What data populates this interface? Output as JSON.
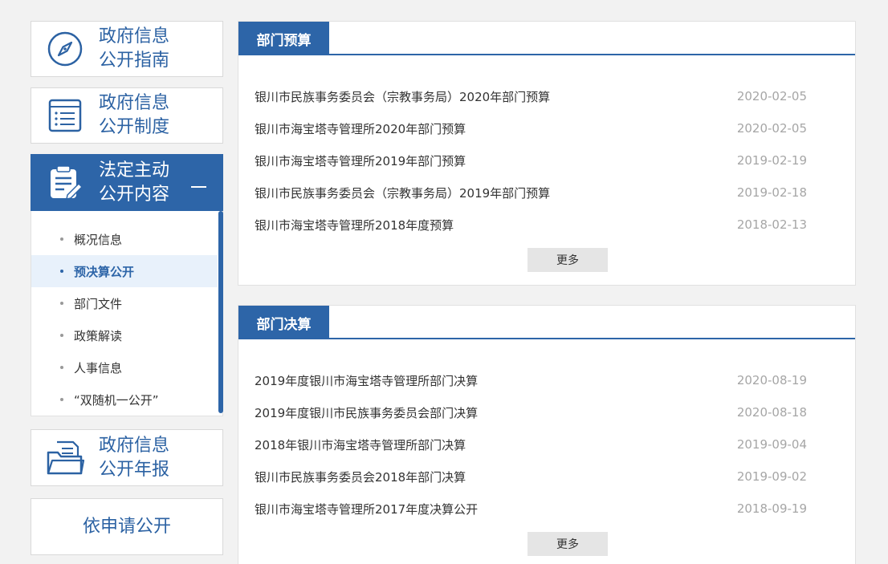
{
  "sidebar": {
    "guide_label": "政府信息\n公开指南",
    "system_label": "政府信息\n公开制度",
    "statutory_label": "法定主动\n公开内容",
    "annual_label": "政府信息\n公开年报",
    "apply_label": "依申请公开",
    "sub_items": [
      {
        "label": "概况信息"
      },
      {
        "label": "预决算公开"
      },
      {
        "label": "部门文件"
      },
      {
        "label": "政策解读"
      },
      {
        "label": "人事信息"
      },
      {
        "label": "“双随机一公开”"
      }
    ]
  },
  "budget": {
    "title": "部门预算",
    "more": "更多",
    "items": [
      {
        "title": "银川市民族事务委员会（宗教事务局）2020年部门预算",
        "date": "2020-02-05"
      },
      {
        "title": "银川市海宝塔寺管理所2020年部门预算",
        "date": "2020-02-05"
      },
      {
        "title": "银川市海宝塔寺管理所2019年部门预算",
        "date": "2019-02-19"
      },
      {
        "title": "银川市民族事务委员会（宗教事务局）2019年部门预算",
        "date": "2019-02-18"
      },
      {
        "title": "银川市海宝塔寺管理所2018年度预算",
        "date": "2018-02-13"
      }
    ]
  },
  "final": {
    "title": "部门决算",
    "more": "更多",
    "items": [
      {
        "title": "2019年度银川市海宝塔寺管理所部门决算",
        "date": "2020-08-19"
      },
      {
        "title": "2019年度银川市民族事务委员会部门决算",
        "date": "2020-08-18"
      },
      {
        "title": "2018年银川市海宝塔寺管理所部门决算",
        "date": "2019-09-04"
      },
      {
        "title": "银川市民族事务委员会2018年部门决算",
        "date": "2019-09-02"
      },
      {
        "title": "银川市海宝塔寺管理所2017年度决算公开",
        "date": "2018-09-19"
      }
    ]
  }
}
